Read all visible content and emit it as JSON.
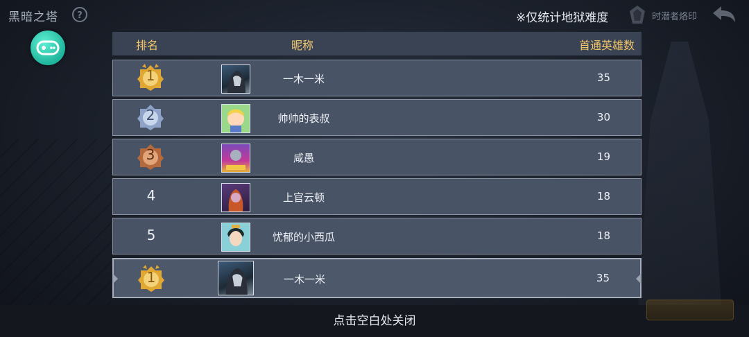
{
  "topbar": {
    "title": "黑暗之塔",
    "help_icon": "?",
    "notice": "※仅统计地狱难度",
    "mark_label": "时潜者烙印"
  },
  "table": {
    "header": {
      "rank": "排名",
      "nickname": "昵称",
      "count": "首通英雄数"
    },
    "rows": [
      {
        "rank": "1",
        "nickname": "一木一米",
        "count": "35",
        "badge": "gold"
      },
      {
        "rank": "2",
        "nickname": "帅帅的表叔",
        "count": "30",
        "badge": "silver"
      },
      {
        "rank": "3",
        "nickname": "咸愚",
        "count": "19",
        "badge": "bronze"
      },
      {
        "rank": "4",
        "nickname": "上官云顿",
        "count": "18",
        "badge": "none"
      },
      {
        "rank": "5",
        "nickname": "忧郁的小西瓜",
        "count": "18",
        "badge": "none"
      }
    ],
    "self_row": {
      "rank": "1",
      "nickname": "一木一米",
      "count": "35",
      "badge": "gold"
    }
  },
  "footer": {
    "close_hint": "点击空白处关闭"
  },
  "colors": {
    "gold": "#e0a732",
    "silver": "#8fa3c8",
    "bronze": "#b46a3c",
    "header_text": "#f2c66b",
    "accent": "#2fd0b4"
  }
}
